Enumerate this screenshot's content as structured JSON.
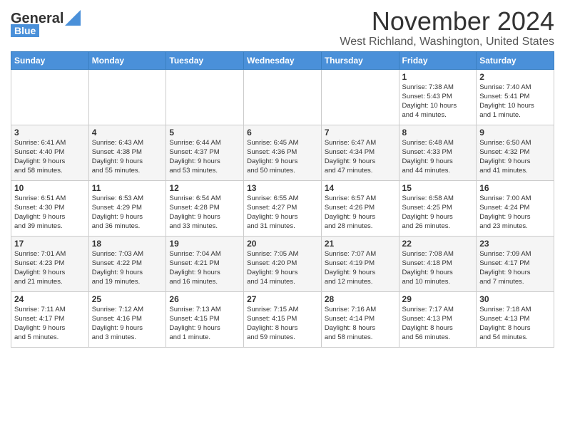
{
  "header": {
    "logo_general": "General",
    "logo_blue": "Blue",
    "month": "November 2024",
    "location": "West Richland, Washington, United States"
  },
  "days_of_week": [
    "Sunday",
    "Monday",
    "Tuesday",
    "Wednesday",
    "Thursday",
    "Friday",
    "Saturday"
  ],
  "weeks": [
    [
      {
        "day": "",
        "info": ""
      },
      {
        "day": "",
        "info": ""
      },
      {
        "day": "",
        "info": ""
      },
      {
        "day": "",
        "info": ""
      },
      {
        "day": "",
        "info": ""
      },
      {
        "day": "1",
        "info": "Sunrise: 7:38 AM\nSunset: 5:43 PM\nDaylight: 10 hours\nand 4 minutes."
      },
      {
        "day": "2",
        "info": "Sunrise: 7:40 AM\nSunset: 5:41 PM\nDaylight: 10 hours\nand 1 minute."
      }
    ],
    [
      {
        "day": "3",
        "info": "Sunrise: 6:41 AM\nSunset: 4:40 PM\nDaylight: 9 hours\nand 58 minutes."
      },
      {
        "day": "4",
        "info": "Sunrise: 6:43 AM\nSunset: 4:38 PM\nDaylight: 9 hours\nand 55 minutes."
      },
      {
        "day": "5",
        "info": "Sunrise: 6:44 AM\nSunset: 4:37 PM\nDaylight: 9 hours\nand 53 minutes."
      },
      {
        "day": "6",
        "info": "Sunrise: 6:45 AM\nSunset: 4:36 PM\nDaylight: 9 hours\nand 50 minutes."
      },
      {
        "day": "7",
        "info": "Sunrise: 6:47 AM\nSunset: 4:34 PM\nDaylight: 9 hours\nand 47 minutes."
      },
      {
        "day": "8",
        "info": "Sunrise: 6:48 AM\nSunset: 4:33 PM\nDaylight: 9 hours\nand 44 minutes."
      },
      {
        "day": "9",
        "info": "Sunrise: 6:50 AM\nSunset: 4:32 PM\nDaylight: 9 hours\nand 41 minutes."
      }
    ],
    [
      {
        "day": "10",
        "info": "Sunrise: 6:51 AM\nSunset: 4:30 PM\nDaylight: 9 hours\nand 39 minutes."
      },
      {
        "day": "11",
        "info": "Sunrise: 6:53 AM\nSunset: 4:29 PM\nDaylight: 9 hours\nand 36 minutes."
      },
      {
        "day": "12",
        "info": "Sunrise: 6:54 AM\nSunset: 4:28 PM\nDaylight: 9 hours\nand 33 minutes."
      },
      {
        "day": "13",
        "info": "Sunrise: 6:55 AM\nSunset: 4:27 PM\nDaylight: 9 hours\nand 31 minutes."
      },
      {
        "day": "14",
        "info": "Sunrise: 6:57 AM\nSunset: 4:26 PM\nDaylight: 9 hours\nand 28 minutes."
      },
      {
        "day": "15",
        "info": "Sunrise: 6:58 AM\nSunset: 4:25 PM\nDaylight: 9 hours\nand 26 minutes."
      },
      {
        "day": "16",
        "info": "Sunrise: 7:00 AM\nSunset: 4:24 PM\nDaylight: 9 hours\nand 23 minutes."
      }
    ],
    [
      {
        "day": "17",
        "info": "Sunrise: 7:01 AM\nSunset: 4:23 PM\nDaylight: 9 hours\nand 21 minutes."
      },
      {
        "day": "18",
        "info": "Sunrise: 7:03 AM\nSunset: 4:22 PM\nDaylight: 9 hours\nand 19 minutes."
      },
      {
        "day": "19",
        "info": "Sunrise: 7:04 AM\nSunset: 4:21 PM\nDaylight: 9 hours\nand 16 minutes."
      },
      {
        "day": "20",
        "info": "Sunrise: 7:05 AM\nSunset: 4:20 PM\nDaylight: 9 hours\nand 14 minutes."
      },
      {
        "day": "21",
        "info": "Sunrise: 7:07 AM\nSunset: 4:19 PM\nDaylight: 9 hours\nand 12 minutes."
      },
      {
        "day": "22",
        "info": "Sunrise: 7:08 AM\nSunset: 4:18 PM\nDaylight: 9 hours\nand 10 minutes."
      },
      {
        "day": "23",
        "info": "Sunrise: 7:09 AM\nSunset: 4:17 PM\nDaylight: 9 hours\nand 7 minutes."
      }
    ],
    [
      {
        "day": "24",
        "info": "Sunrise: 7:11 AM\nSunset: 4:17 PM\nDaylight: 9 hours\nand 5 minutes."
      },
      {
        "day": "25",
        "info": "Sunrise: 7:12 AM\nSunset: 4:16 PM\nDaylight: 9 hours\nand 3 minutes."
      },
      {
        "day": "26",
        "info": "Sunrise: 7:13 AM\nSunset: 4:15 PM\nDaylight: 9 hours\nand 1 minute."
      },
      {
        "day": "27",
        "info": "Sunrise: 7:15 AM\nSunset: 4:15 PM\nDaylight: 8 hours\nand 59 minutes."
      },
      {
        "day": "28",
        "info": "Sunrise: 7:16 AM\nSunset: 4:14 PM\nDaylight: 8 hours\nand 58 minutes."
      },
      {
        "day": "29",
        "info": "Sunrise: 7:17 AM\nSunset: 4:13 PM\nDaylight: 8 hours\nand 56 minutes."
      },
      {
        "day": "30",
        "info": "Sunrise: 7:18 AM\nSunset: 4:13 PM\nDaylight: 8 hours\nand 54 minutes."
      }
    ]
  ]
}
